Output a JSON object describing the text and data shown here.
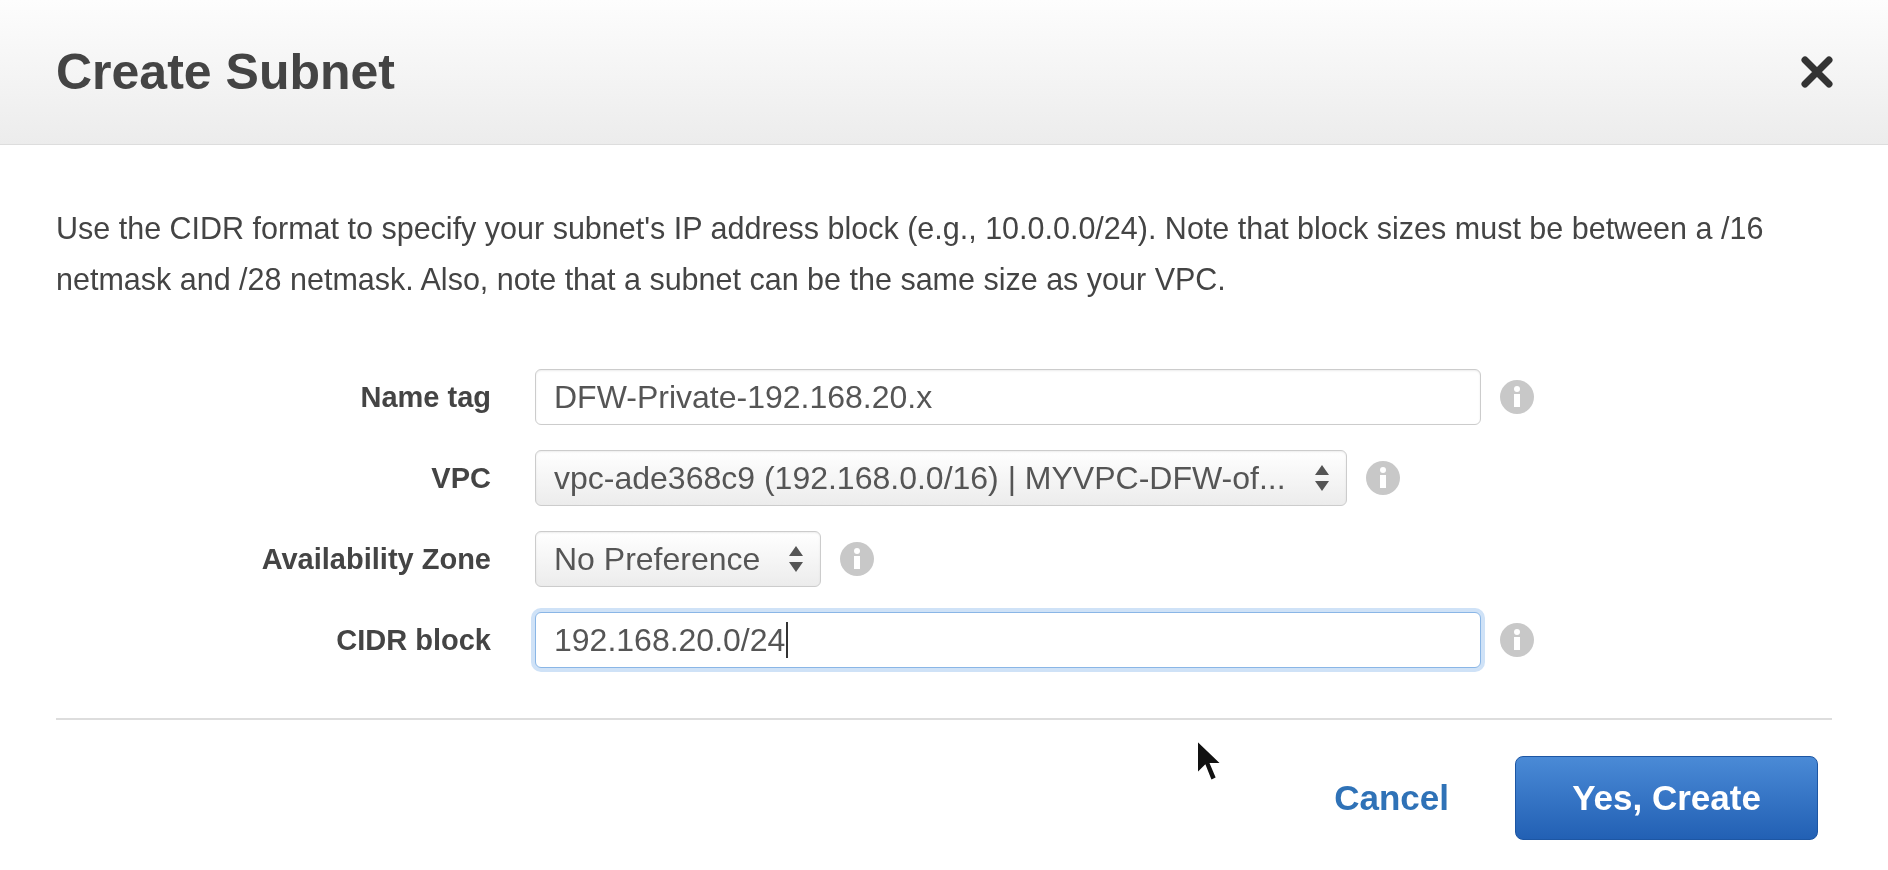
{
  "dialog": {
    "title": "Create Subnet"
  },
  "description": "Use the CIDR format to specify your subnet's IP address block (e.g., 10.0.0.0/24). Note that block sizes must be between a /16 netmask and /28 netmask. Also, note that a subnet can be the same size as your VPC.",
  "fields": [
    {
      "kind": "text",
      "label": "Name tag",
      "value": "DFW-Private-192.168.20.x",
      "focused": false
    },
    {
      "kind": "select",
      "label": "VPC",
      "value": "vpc-ade368c9 (192.168.0.0/16) | MYVPC-DFW-of...",
      "focused": false
    },
    {
      "kind": "select",
      "label": "Availability Zone",
      "value": "No Preference",
      "focused": false
    },
    {
      "kind": "text",
      "label": "CIDR block",
      "value": "192.168.20.0/24",
      "focused": true
    }
  ],
  "buttons": [
    {
      "kind": "link",
      "label": "Cancel"
    },
    {
      "kind": "primary",
      "label": "Yes, Create"
    }
  ]
}
